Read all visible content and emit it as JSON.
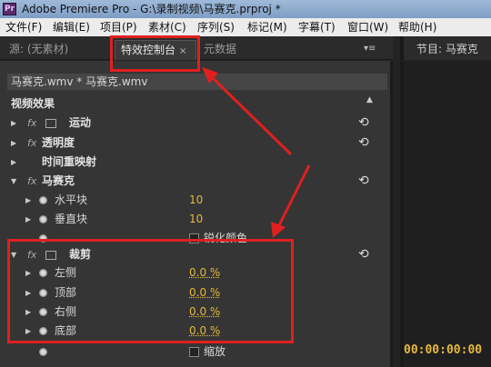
{
  "window": {
    "title": "Adobe Premiere Pro - G:\\录制视频\\马赛克.prproj *",
    "app_icon": "Pr"
  },
  "menu": [
    "文件(F)",
    "编辑(E)",
    "项目(P)",
    "素材(C)",
    "序列(S)",
    "标记(M)",
    "字幕(T)",
    "窗口(W)",
    "帮助(H)"
  ],
  "tabs": {
    "source": "源: (无素材)",
    "effect_controls": "特效控制台",
    "metadata": "元数据",
    "close": "×",
    "menu": "▾≡",
    "program": "节目: 马赛克"
  },
  "effect_controls": {
    "clip": "马赛克.wmv * 马赛克.wmv",
    "video_effects": "视频效果",
    "motion": "运动",
    "opacity": "透明度",
    "time_remap": "时间重映射",
    "mosaic": {
      "name": "马赛克",
      "params": [
        {
          "label": "水平块",
          "value": "10"
        },
        {
          "label": "垂直块",
          "value": "10"
        }
      ],
      "sharpen_label": "锐化颜色"
    },
    "crop": {
      "name": "裁剪",
      "params": [
        {
          "label": "左侧",
          "value": "0.0 %"
        },
        {
          "label": "顶部",
          "value": "0.0 %"
        },
        {
          "label": "右侧",
          "value": "0.0 %"
        },
        {
          "label": "底部",
          "value": "0.0 %"
        }
      ],
      "zoom_label": "缩放"
    }
  },
  "program": {
    "timecode": "00:00:00:00"
  },
  "colors": {
    "annotation": "#e0201f",
    "value": "#e8b83c"
  }
}
